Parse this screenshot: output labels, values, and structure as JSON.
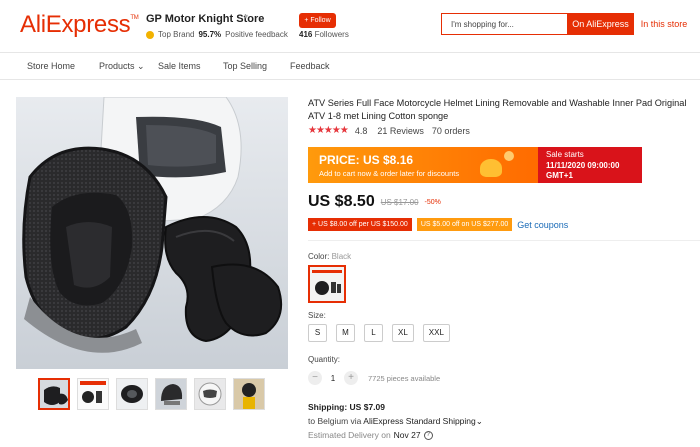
{
  "header": {
    "logo": "AliExpress",
    "logo_tm": "TM",
    "store_name": "GP Motor Knight Store",
    "top_brand": "Top Brand",
    "feedback_pct": "95.7%",
    "feedback_text": "Positive feedback",
    "follow_label": "+ Follow",
    "followers_count": "416",
    "followers_text": "Followers",
    "search_placeholder": "I'm shopping for...",
    "on_aliexpress": "On AliExpress",
    "in_this_store": "In this store"
  },
  "nav": {
    "items": [
      "Store Home",
      "Products",
      "Sale Items",
      "Top Selling",
      "Feedback"
    ]
  },
  "product": {
    "title": "ATV Series Full Face Motorcycle Helmet Lining Removable and Washable Inner Pad Original ATV 1-8 met Lining Cotton sponge",
    "stars": "★★★★★",
    "rating": "4.8",
    "reviews": "21 Reviews",
    "orders": "70 orders",
    "promo_price": "PRICE: US $8.16",
    "promo_sub": "Add to cart now & order later for discounts",
    "sale_starts": "Sale starts",
    "sale_date": "11/11/2020 09:00:00 GMT+1",
    "price": "US $8.50",
    "old_price": "US $17.00",
    "discount": "-50%",
    "coupon_1": "+ US $8.00 off per US $150.00",
    "coupon_2": "US $5.00 off on US $277.00",
    "get_coupons": "Get coupons",
    "color_label": "Color:",
    "color_value": "Black",
    "size_label": "Size:",
    "sizes": [
      "S",
      "M",
      "L",
      "XL",
      "XXL"
    ],
    "quantity_label": "Quantity:",
    "quantity": "1",
    "qty_minus": "−",
    "qty_plus": "+",
    "available": "7725 pieces available",
    "shipping": "Shipping: US $7.09",
    "ship_to_prefix": "to Belgium via",
    "ship_method": "AliExpress Standard Shipping",
    "delivery_prefix": "Estimated Delivery on",
    "delivery_date": "Nov 27"
  },
  "colors": {
    "brand": "#e62e04",
    "star": "#e6373d",
    "link": "#1a6bb8",
    "promo_orange": "#ff7a00",
    "sale_red": "#d9131a"
  }
}
